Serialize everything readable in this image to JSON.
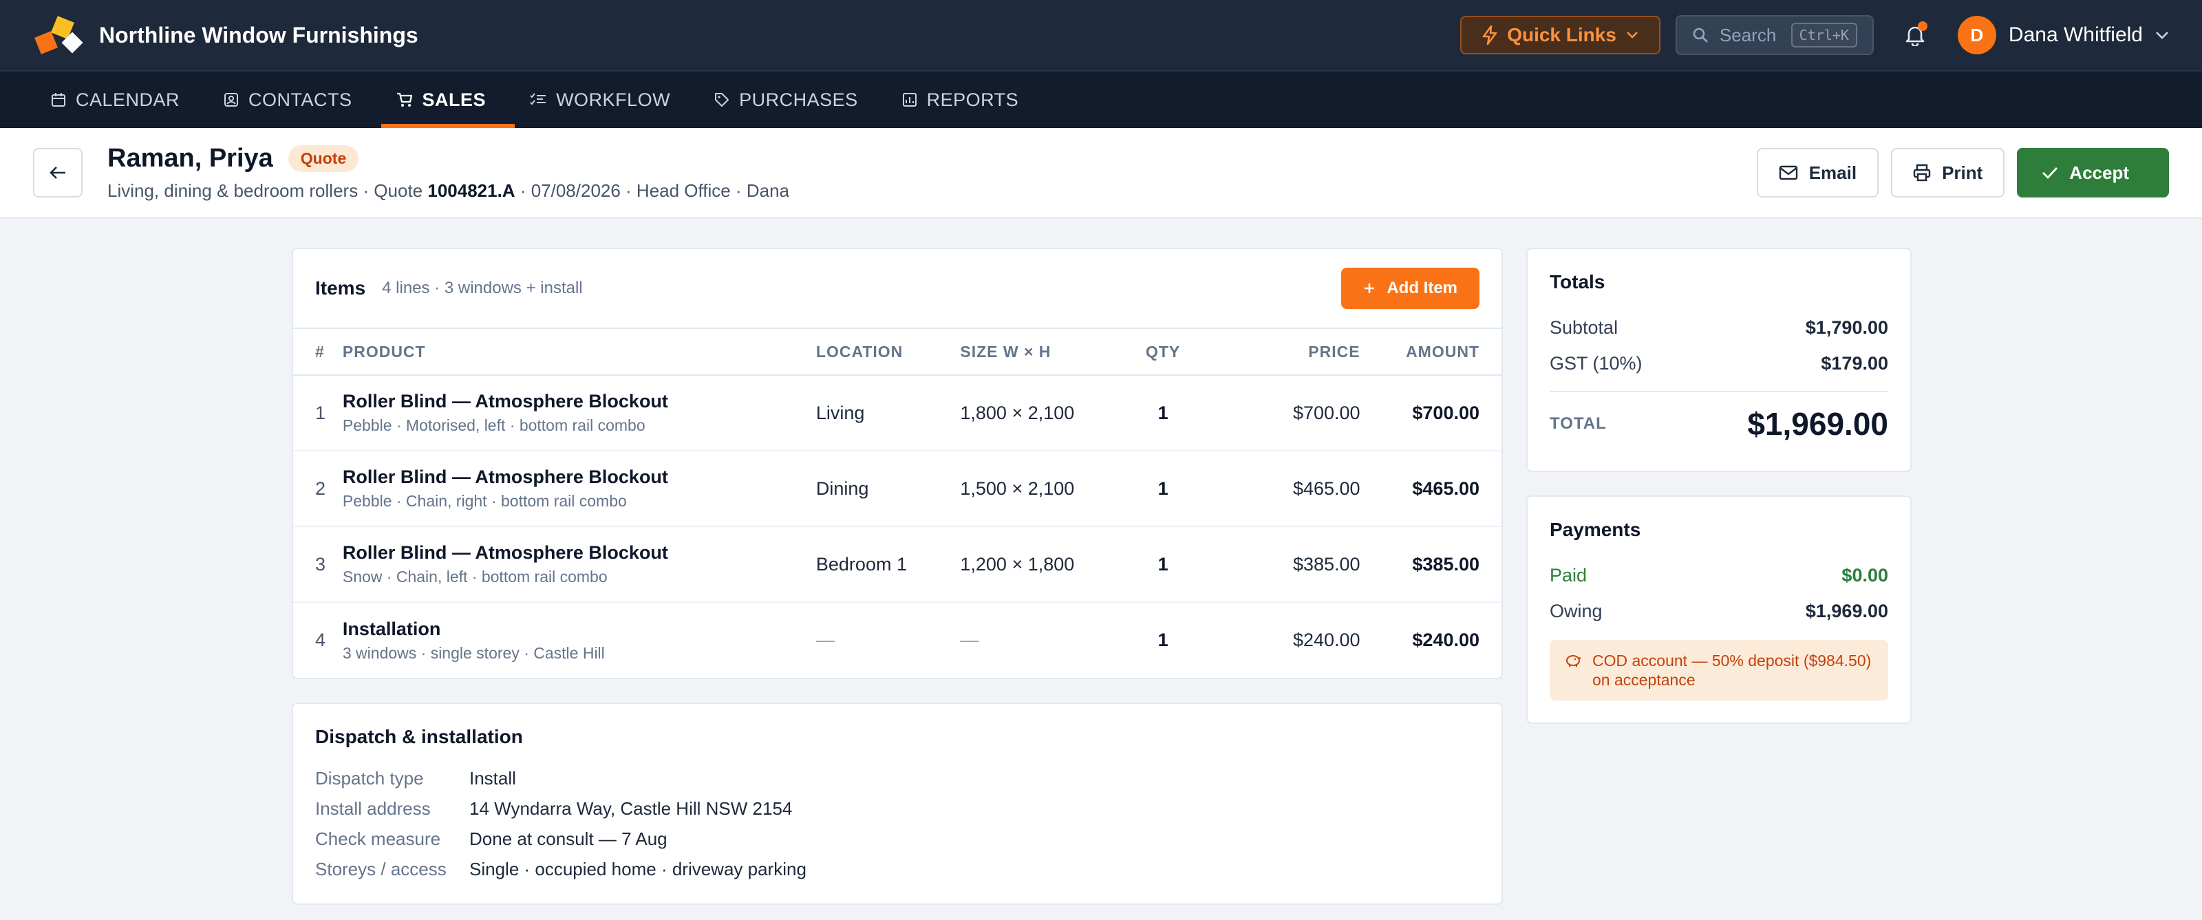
{
  "app": {
    "brand": "Northline Window Furnishings",
    "quick_links": "Quick Links",
    "search_placeholder": "Search",
    "search_shortcut": "Ctrl+K",
    "user": {
      "initial": "D",
      "name": "Dana Whitfield"
    }
  },
  "nav": {
    "items": [
      {
        "label": "CALENDAR",
        "icon": "calendar-icon"
      },
      {
        "label": "CONTACTS",
        "icon": "contact-card-icon"
      },
      {
        "label": "SALES",
        "icon": "cart-icon",
        "active": true
      },
      {
        "label": "WORKFLOW",
        "icon": "checklist-icon"
      },
      {
        "label": "PURCHASES",
        "icon": "tag-icon"
      },
      {
        "label": "REPORTS",
        "icon": "report-icon"
      }
    ]
  },
  "header": {
    "customer": "Raman, Priya",
    "status": "Quote",
    "sub_prefix": "Living, dining & bedroom rollers · Quote ",
    "quote_number": "1004821.A",
    "sub_suffix": " · 07/08/2026 · Head Office · Dana",
    "actions": {
      "email": "Email",
      "print": "Print",
      "accept": "Accept"
    }
  },
  "items": {
    "title": "Items",
    "meta": "4 lines · 3 windows + install",
    "add_label": "Add Item",
    "columns": {
      "num": "#",
      "product": "PRODUCT",
      "location": "LOCATION",
      "size": "SIZE W × H",
      "qty": "QTY",
      "price": "PRICE",
      "amount": "AMOUNT"
    },
    "rows": [
      {
        "num": "1",
        "product": "Roller Blind — Atmosphere Blockout",
        "desc": "Pebble · Motorised, left · bottom rail combo",
        "location": "Living",
        "size": "1,800 × 2,100",
        "qty": "1",
        "price": "$700.00",
        "amount": "$700.00"
      },
      {
        "num": "2",
        "product": "Roller Blind — Atmosphere Blockout",
        "desc": "Pebble · Chain, right · bottom rail combo",
        "location": "Dining",
        "size": "1,500 × 2,100",
        "qty": "1",
        "price": "$465.00",
        "amount": "$465.00"
      },
      {
        "num": "3",
        "product": "Roller Blind — Atmosphere Blockout",
        "desc": "Snow · Chain, left · bottom rail combo",
        "location": "Bedroom 1",
        "size": "1,200 × 1,800",
        "qty": "1",
        "price": "$385.00",
        "amount": "$385.00"
      },
      {
        "num": "4",
        "product": "Installation",
        "desc": "3 windows · single storey · Castle Hill",
        "location": "—",
        "size": "—",
        "qty": "1",
        "price": "$240.00",
        "amount": "$240.00"
      }
    ]
  },
  "dispatch": {
    "title": "Dispatch & installation",
    "fields": [
      {
        "key": "Dispatch type",
        "value": "Install"
      },
      {
        "key": "Install address",
        "value": "14 Wyndarra Way, Castle Hill NSW 2154"
      },
      {
        "key": "Check measure",
        "value": "Done at consult — 7 Aug"
      },
      {
        "key": "Storeys / access",
        "value": "Single · occupied home · driveway parking"
      }
    ]
  },
  "totals": {
    "title": "Totals",
    "subtotal_label": "Subtotal",
    "subtotal": "$1,790.00",
    "gst_label": "GST (10%)",
    "gst": "$179.00",
    "total_label": "TOTAL",
    "total": "$1,969.00"
  },
  "payments": {
    "title": "Payments",
    "paid_label": "Paid",
    "paid": "$0.00",
    "owing_label": "Owing",
    "owing": "$1,969.00",
    "note": "COD account — 50% deposit ($984.50) on acceptance"
  },
  "colors": {
    "accent": "#f97316",
    "success": "#2e7d3a",
    "topbar": "#1e293b"
  }
}
